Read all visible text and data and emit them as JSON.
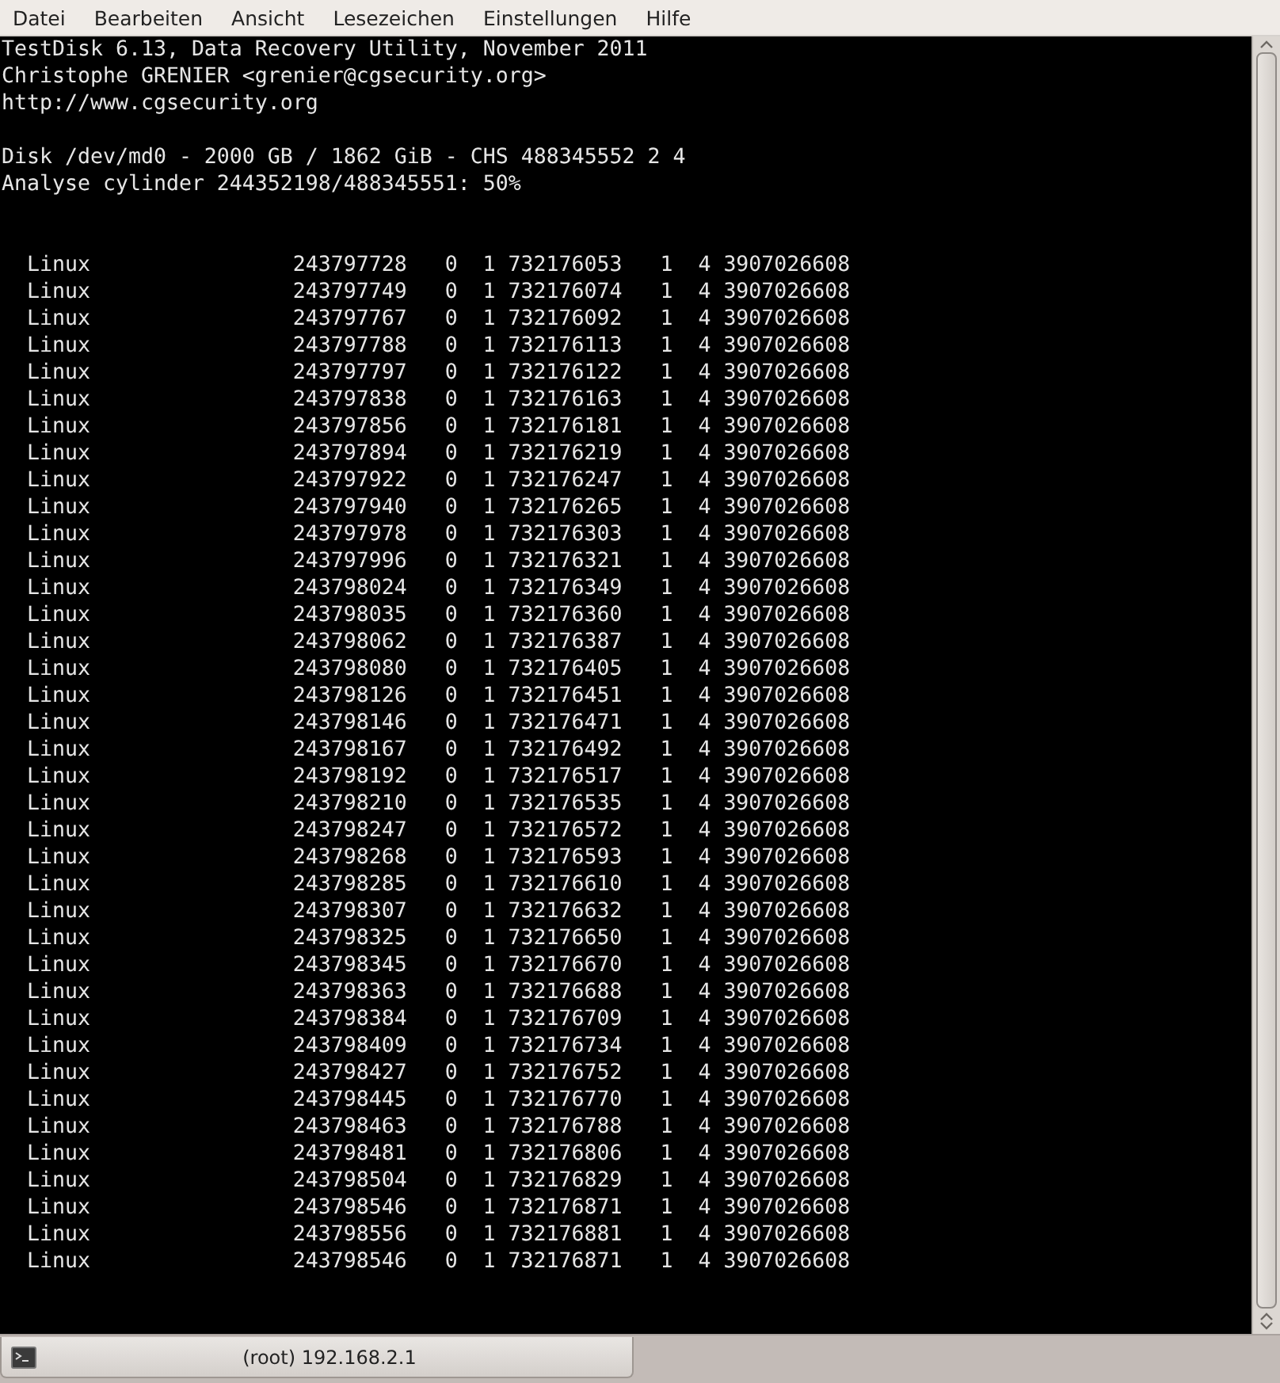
{
  "menu_bar": {
    "items": [
      "Datei",
      "Bearbeiten",
      "Ansicht",
      "Lesezeichen",
      "Einstellungen",
      "Hilfe"
    ]
  },
  "terminal": {
    "header": [
      "TestDisk 6.13, Data Recovery Utility, November 2011",
      "Christophe GRENIER <grenier@cgsecurity.org>",
      "http://www.cgsecurity.org"
    ],
    "disk_info": [
      "Disk /dev/md0 - 2000 GB / 1862 GiB - CHS 488345552 2 4",
      "Analyse cylinder 244352198/488345551: 50%"
    ],
    "rows": [
      [
        "Linux",
        "243797728",
        "0",
        "1",
        "732176053",
        "1",
        "4",
        "3907026608"
      ],
      [
        "Linux",
        "243797749",
        "0",
        "1",
        "732176074",
        "1",
        "4",
        "3907026608"
      ],
      [
        "Linux",
        "243797767",
        "0",
        "1",
        "732176092",
        "1",
        "4",
        "3907026608"
      ],
      [
        "Linux",
        "243797788",
        "0",
        "1",
        "732176113",
        "1",
        "4",
        "3907026608"
      ],
      [
        "Linux",
        "243797797",
        "0",
        "1",
        "732176122",
        "1",
        "4",
        "3907026608"
      ],
      [
        "Linux",
        "243797838",
        "0",
        "1",
        "732176163",
        "1",
        "4",
        "3907026608"
      ],
      [
        "Linux",
        "243797856",
        "0",
        "1",
        "732176181",
        "1",
        "4",
        "3907026608"
      ],
      [
        "Linux",
        "243797894",
        "0",
        "1",
        "732176219",
        "1",
        "4",
        "3907026608"
      ],
      [
        "Linux",
        "243797922",
        "0",
        "1",
        "732176247",
        "1",
        "4",
        "3907026608"
      ],
      [
        "Linux",
        "243797940",
        "0",
        "1",
        "732176265",
        "1",
        "4",
        "3907026608"
      ],
      [
        "Linux",
        "243797978",
        "0",
        "1",
        "732176303",
        "1",
        "4",
        "3907026608"
      ],
      [
        "Linux",
        "243797996",
        "0",
        "1",
        "732176321",
        "1",
        "4",
        "3907026608"
      ],
      [
        "Linux",
        "243798024",
        "0",
        "1",
        "732176349",
        "1",
        "4",
        "3907026608"
      ],
      [
        "Linux",
        "243798035",
        "0",
        "1",
        "732176360",
        "1",
        "4",
        "3907026608"
      ],
      [
        "Linux",
        "243798062",
        "0",
        "1",
        "732176387",
        "1",
        "4",
        "3907026608"
      ],
      [
        "Linux",
        "243798080",
        "0",
        "1",
        "732176405",
        "1",
        "4",
        "3907026608"
      ],
      [
        "Linux",
        "243798126",
        "0",
        "1",
        "732176451",
        "1",
        "4",
        "3907026608"
      ],
      [
        "Linux",
        "243798146",
        "0",
        "1",
        "732176471",
        "1",
        "4",
        "3907026608"
      ],
      [
        "Linux",
        "243798167",
        "0",
        "1",
        "732176492",
        "1",
        "4",
        "3907026608"
      ],
      [
        "Linux",
        "243798192",
        "0",
        "1",
        "732176517",
        "1",
        "4",
        "3907026608"
      ],
      [
        "Linux",
        "243798210",
        "0",
        "1",
        "732176535",
        "1",
        "4",
        "3907026608"
      ],
      [
        "Linux",
        "243798247",
        "0",
        "1",
        "732176572",
        "1",
        "4",
        "3907026608"
      ],
      [
        "Linux",
        "243798268",
        "0",
        "1",
        "732176593",
        "1",
        "4",
        "3907026608"
      ],
      [
        "Linux",
        "243798285",
        "0",
        "1",
        "732176610",
        "1",
        "4",
        "3907026608"
      ],
      [
        "Linux",
        "243798307",
        "0",
        "1",
        "732176632",
        "1",
        "4",
        "3907026608"
      ],
      [
        "Linux",
        "243798325",
        "0",
        "1",
        "732176650",
        "1",
        "4",
        "3907026608"
      ],
      [
        "Linux",
        "243798345",
        "0",
        "1",
        "732176670",
        "1",
        "4",
        "3907026608"
      ],
      [
        "Linux",
        "243798363",
        "0",
        "1",
        "732176688",
        "1",
        "4",
        "3907026608"
      ],
      [
        "Linux",
        "243798384",
        "0",
        "1",
        "732176709",
        "1",
        "4",
        "3907026608"
      ],
      [
        "Linux",
        "243798409",
        "0",
        "1",
        "732176734",
        "1",
        "4",
        "3907026608"
      ],
      [
        "Linux",
        "243798427",
        "0",
        "1",
        "732176752",
        "1",
        "4",
        "3907026608"
      ],
      [
        "Linux",
        "243798445",
        "0",
        "1",
        "732176770",
        "1",
        "4",
        "3907026608"
      ],
      [
        "Linux",
        "243798463",
        "0",
        "1",
        "732176788",
        "1",
        "4",
        "3907026608"
      ],
      [
        "Linux",
        "243798481",
        "0",
        "1",
        "732176806",
        "1",
        "4",
        "3907026608"
      ],
      [
        "Linux",
        "243798504",
        "0",
        "1",
        "732176829",
        "1",
        "4",
        "3907026608"
      ],
      [
        "Linux",
        "243798546",
        "0",
        "1",
        "732176871",
        "1",
        "4",
        "3907026608"
      ],
      [
        "Linux",
        "243798556",
        "0",
        "1",
        "732176881",
        "1",
        "4",
        "3907026608"
      ],
      [
        "Linux",
        "243798546",
        "0",
        "1",
        "732176871",
        "1",
        "4",
        "3907026608"
      ]
    ]
  },
  "tab_bar": {
    "tabs": [
      {
        "label": "(root) 192.168.2.1",
        "selected": true
      }
    ]
  }
}
